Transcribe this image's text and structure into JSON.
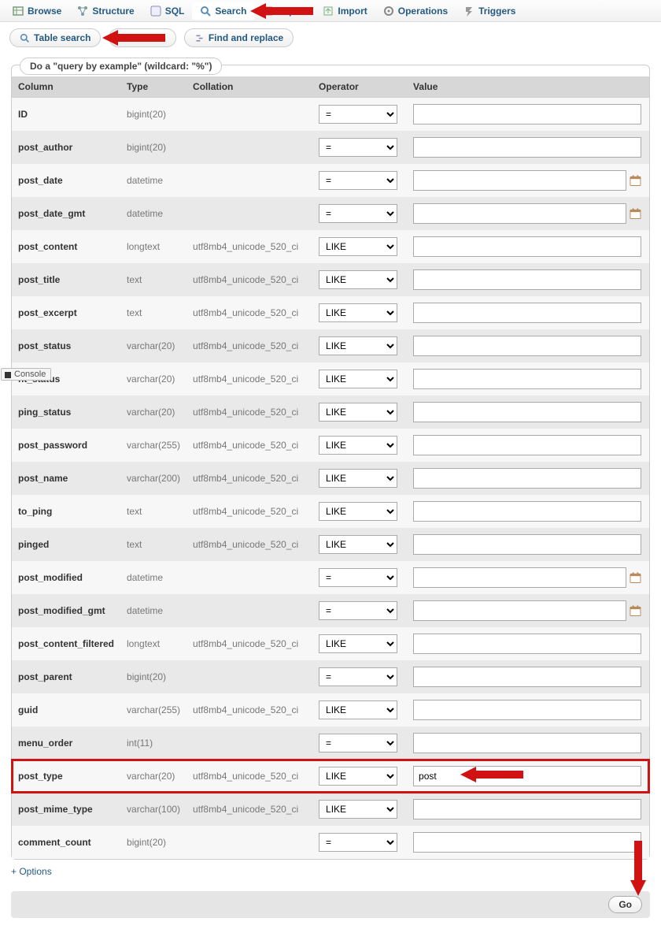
{
  "topnav": {
    "tabs": [
      {
        "label": "Browse",
        "icon": "table"
      },
      {
        "label": "Structure",
        "icon": "structure"
      },
      {
        "label": "SQL",
        "icon": "sql"
      },
      {
        "label": "Search",
        "icon": "search",
        "active": true
      },
      {
        "label": "Export",
        "icon": "export"
      },
      {
        "label": "Import",
        "icon": "import"
      },
      {
        "label": "Operations",
        "icon": "operations"
      },
      {
        "label": "Triggers",
        "icon": "triggers"
      }
    ]
  },
  "subnav": {
    "table_search": "Table search",
    "zoom_search_fragment": "arch",
    "find_replace": "Find and replace"
  },
  "console_label": "Console",
  "legend": "Do a \"query by example\" (wildcard: \"%\")",
  "headers": {
    "column": "Column",
    "type": "Type",
    "collation": "Collation",
    "operator": "Operator",
    "value": "Value"
  },
  "collation_default": "utf8mb4_unicode_520_ci",
  "rows": [
    {
      "col": "ID",
      "type": "bigint(20)",
      "coll": "",
      "op": "=",
      "val": "",
      "cal": false
    },
    {
      "col": "post_author",
      "type": "bigint(20)",
      "coll": "",
      "op": "=",
      "val": "",
      "cal": false
    },
    {
      "col": "post_date",
      "type": "datetime",
      "coll": "",
      "op": "=",
      "val": "",
      "cal": true
    },
    {
      "col": "post_date_gmt",
      "type": "datetime",
      "coll": "",
      "op": "=",
      "val": "",
      "cal": true
    },
    {
      "col": "post_content",
      "type": "longtext",
      "coll": "utf8mb4_unicode_520_ci",
      "op": "LIKE",
      "val": "",
      "cal": false
    },
    {
      "col": "post_title",
      "type": "text",
      "coll": "utf8mb4_unicode_520_ci",
      "op": "LIKE",
      "val": "",
      "cal": false
    },
    {
      "col": "post_excerpt",
      "type": "text",
      "coll": "utf8mb4_unicode_520_ci",
      "op": "LIKE",
      "val": "",
      "cal": false
    },
    {
      "col": "post_status",
      "type": "varchar(20)",
      "coll": "utf8mb4_unicode_520_ci",
      "op": "LIKE",
      "val": "",
      "cal": false
    },
    {
      "col": "comment_status",
      "type": "varchar(20)",
      "coll": "utf8mb4_unicode_520_ci",
      "op": "LIKE",
      "val": "",
      "cal": false,
      "partial_label": "nt_status"
    },
    {
      "col": "ping_status",
      "type": "varchar(20)",
      "coll": "utf8mb4_unicode_520_ci",
      "op": "LIKE",
      "val": "",
      "cal": false
    },
    {
      "col": "post_password",
      "type": "varchar(255)",
      "coll": "utf8mb4_unicode_520_ci",
      "op": "LIKE",
      "val": "",
      "cal": false
    },
    {
      "col": "post_name",
      "type": "varchar(200)",
      "coll": "utf8mb4_unicode_520_ci",
      "op": "LIKE",
      "val": "",
      "cal": false
    },
    {
      "col": "to_ping",
      "type": "text",
      "coll": "utf8mb4_unicode_520_ci",
      "op": "LIKE",
      "val": "",
      "cal": false
    },
    {
      "col": "pinged",
      "type": "text",
      "coll": "utf8mb4_unicode_520_ci",
      "op": "LIKE",
      "val": "",
      "cal": false
    },
    {
      "col": "post_modified",
      "type": "datetime",
      "coll": "",
      "op": "=",
      "val": "",
      "cal": true
    },
    {
      "col": "post_modified_gmt",
      "type": "datetime",
      "coll": "",
      "op": "=",
      "val": "",
      "cal": true
    },
    {
      "col": "post_content_filtered",
      "type": "longtext",
      "coll": "utf8mb4_unicode_520_ci",
      "op": "LIKE",
      "val": "",
      "cal": false
    },
    {
      "col": "post_parent",
      "type": "bigint(20)",
      "coll": "",
      "op": "=",
      "val": "",
      "cal": false
    },
    {
      "col": "guid",
      "type": "varchar(255)",
      "coll": "utf8mb4_unicode_520_ci",
      "op": "LIKE",
      "val": "",
      "cal": false
    },
    {
      "col": "menu_order",
      "type": "int(11)",
      "coll": "",
      "op": "=",
      "val": "",
      "cal": false
    },
    {
      "col": "post_type",
      "type": "varchar(20)",
      "coll": "utf8mb4_unicode_520_ci",
      "op": "LIKE",
      "val": "post",
      "cal": false,
      "highlight": true
    },
    {
      "col": "post_mime_type",
      "type": "varchar(100)",
      "coll": "utf8mb4_unicode_520_ci",
      "op": "LIKE",
      "val": "",
      "cal": false
    },
    {
      "col": "comment_count",
      "type": "bigint(20)",
      "coll": "",
      "op": "=",
      "val": "",
      "cal": false
    }
  ],
  "options_link": "+ Options",
  "go_label": "Go"
}
